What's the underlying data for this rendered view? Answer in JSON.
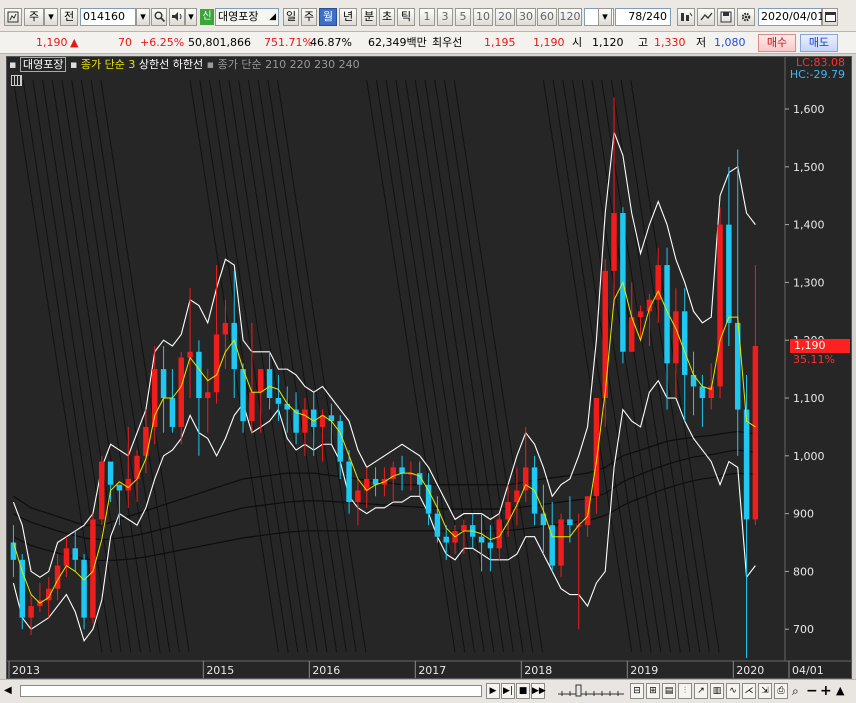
{
  "toolbar": {
    "period_select": "주",
    "prev_label": "전",
    "stock_code": "014160",
    "new_badge": "신",
    "stock_name": "대영포장",
    "period_tabs": [
      "일",
      "주",
      "월",
      "년",
      "분",
      "초",
      "틱"
    ],
    "active_tab": "월",
    "number_tabs": [
      "1",
      "3",
      "5",
      "10",
      "20",
      "30",
      "60",
      "120"
    ],
    "count": "78",
    "total": "/240",
    "date": "2020/04/01"
  },
  "quote": {
    "price": "1,190",
    "change": "70",
    "change_pct": "+6.25%",
    "volume": "50,801,866",
    "vol_ratio": "751.71%",
    "turnover": "46.87%",
    "amount": "62,349백만",
    "best_ask_label": "최우선",
    "best_ask": "1,195",
    "best_bid": "1,190",
    "open_label": "시",
    "open": "1,120",
    "high_label": "고",
    "high": "1,330",
    "low_label": "저",
    "low": "1,080",
    "buy_label": "매수",
    "sell_label": "매도"
  },
  "legend": {
    "name": "대영포장",
    "ma": "종가 단순 3",
    "upper": "상한선",
    "lower": "하한선",
    "ma2": "종가 단순",
    "periods": "210  220  230  240"
  },
  "indicators": {
    "lc": "LC:83.08",
    "hc": "HC:-29.79"
  },
  "price_tag": {
    "value": "1,190",
    "pct": "35.11%"
  },
  "colors": {
    "up": "#f01d1d",
    "down": "#1ec8f0",
    "ma": "#e6e600",
    "band": "#ffffff",
    "bg": "#262626"
  },
  "chart_data": {
    "type": "candlestick",
    "yticks": [
      700,
      800,
      900,
      1000,
      1100,
      1200,
      1300,
      1400,
      1500,
      1600
    ],
    "ytick_labels": [
      "700",
      "800",
      "900",
      "1,000",
      "1,100",
      "1,200",
      "1,300",
      "1,400",
      "1,500",
      "1,600"
    ],
    "ylim": [
      645,
      1690
    ],
    "xtick_labels": [
      "2013",
      "2015",
      "2016",
      "2017",
      "2018",
      "2019",
      "2020",
      "04/01"
    ],
    "xtick_index": [
      0,
      22,
      34,
      46,
      58,
      70,
      82,
      88
    ],
    "candles": [
      [
        850,
        880,
        790,
        820
      ],
      [
        820,
        830,
        700,
        720
      ],
      [
        720,
        760,
        690,
        740
      ],
      [
        740,
        780,
        730,
        750
      ],
      [
        750,
        790,
        720,
        770
      ],
      [
        770,
        830,
        750,
        810
      ],
      [
        810,
        860,
        790,
        840
      ],
      [
        840,
        870,
        800,
        820
      ],
      [
        820,
        830,
        700,
        720
      ],
      [
        720,
        900,
        710,
        890
      ],
      [
        890,
        1000,
        880,
        990
      ],
      [
        990,
        980,
        920,
        950
      ],
      [
        950,
        950,
        880,
        940
      ],
      [
        940,
        1050,
        910,
        960
      ],
      [
        960,
        1010,
        920,
        1000
      ],
      [
        1000,
        1080,
        970,
        1050
      ],
      [
        1050,
        1190,
        1020,
        1150
      ],
      [
        1150,
        1190,
        1040,
        1100
      ],
      [
        1100,
        1150,
        1040,
        1050
      ],
      [
        1050,
        1180,
        1020,
        1170
      ],
      [
        1170,
        1290,
        1100,
        1180
      ],
      [
        1180,
        1200,
        1000,
        1100
      ],
      [
        1100,
        1150,
        1040,
        1110
      ],
      [
        1110,
        1330,
        1090,
        1210
      ],
      [
        1210,
        1270,
        1150,
        1230
      ],
      [
        1230,
        1320,
        1100,
        1150
      ],
      [
        1150,
        1160,
        1040,
        1060
      ],
      [
        1060,
        1230,
        1040,
        1110
      ],
      [
        1110,
        1150,
        1040,
        1150
      ],
      [
        1150,
        1180,
        1080,
        1100
      ],
      [
        1100,
        1140,
        1060,
        1090
      ],
      [
        1090,
        1120,
        1040,
        1080
      ],
      [
        1080,
        1110,
        1020,
        1040
      ],
      [
        1040,
        1100,
        1000,
        1080
      ],
      [
        1080,
        1110,
        1000,
        1050
      ],
      [
        1050,
        1080,
        990,
        1070
      ],
      [
        1070,
        1090,
        1020,
        1060
      ],
      [
        1060,
        1070,
        960,
        990
      ],
      [
        990,
        1010,
        900,
        920
      ],
      [
        920,
        960,
        880,
        940
      ],
      [
        940,
        980,
        910,
        960
      ],
      [
        960,
        980,
        930,
        950
      ],
      [
        950,
        980,
        930,
        960
      ],
      [
        960,
        990,
        920,
        980
      ],
      [
        980,
        1000,
        940,
        970
      ],
      [
        970,
        990,
        940,
        970
      ],
      [
        970,
        990,
        930,
        950
      ],
      [
        950,
        970,
        880,
        900
      ],
      [
        900,
        930,
        850,
        860
      ],
      [
        860,
        880,
        820,
        850
      ],
      [
        850,
        880,
        830,
        870
      ],
      [
        870,
        890,
        830,
        880
      ],
      [
        880,
        900,
        840,
        860
      ],
      [
        860,
        900,
        800,
        850
      ],
      [
        850,
        880,
        800,
        840
      ],
      [
        840,
        900,
        820,
        890
      ],
      [
        890,
        950,
        860,
        920
      ],
      [
        920,
        980,
        880,
        940
      ],
      [
        940,
        1050,
        920,
        980
      ],
      [
        980,
        1000,
        880,
        900
      ],
      [
        900,
        950,
        830,
        880
      ],
      [
        880,
        920,
        800,
        810
      ],
      [
        810,
        900,
        790,
        890
      ],
      [
        890,
        930,
        850,
        880
      ],
      [
        880,
        900,
        700,
        880
      ],
      [
        880,
        930,
        860,
        930
      ],
      [
        930,
        1010,
        900,
        1100
      ],
      [
        1100,
        1340,
        1050,
        1320
      ],
      [
        1320,
        1620,
        1260,
        1420
      ],
      [
        1420,
        1430,
        1160,
        1180
      ],
      [
        1180,
        1300,
        1180,
        1240
      ],
      [
        1240,
        1260,
        1200,
        1250
      ],
      [
        1250,
        1280,
        1190,
        1270
      ],
      [
        1270,
        1360,
        1230,
        1330
      ],
      [
        1330,
        1360,
        1080,
        1160
      ],
      [
        1160,
        1290,
        1100,
        1250
      ],
      [
        1250,
        1290,
        1060,
        1140
      ],
      [
        1140,
        1180,
        1070,
        1120
      ],
      [
        1120,
        1140,
        1050,
        1100
      ],
      [
        1100,
        1160,
        1080,
        1120
      ],
      [
        1120,
        1430,
        1100,
        1400
      ],
      [
        1400,
        1500,
        1190,
        1230
      ],
      [
        1230,
        1530,
        1000,
        1080
      ],
      [
        1080,
        1140,
        650,
        890
      ],
      [
        890,
        1330,
        880,
        1190
      ]
    ],
    "ma3": [
      850,
      800,
      760,
      745,
      755,
      785,
      810,
      800,
      785,
      800,
      855,
      940,
      955,
      945,
      960,
      995,
      1070,
      1100,
      1100,
      1120,
      1170,
      1150,
      1130,
      1140,
      1180,
      1200,
      1150,
      1110,
      1110,
      1120,
      1115,
      1090,
      1075,
      1070,
      1060,
      1070,
      1060,
      1040,
      1000,
      960,
      940,
      950,
      955,
      965,
      970,
      970,
      965,
      940,
      910,
      875,
      860,
      870,
      870,
      865,
      855,
      860,
      885,
      915,
      950,
      940,
      905,
      860,
      860,
      860,
      880,
      895,
      990,
      1110,
      1270,
      1300,
      1240,
      1200,
      1255,
      1285,
      1250,
      1220,
      1180,
      1140,
      1120,
      1115,
      1200,
      1240,
      1240,
      1060,
      1050
    ],
    "upper": [
      920,
      880,
      800,
      790,
      800,
      850,
      860,
      870,
      880,
      900,
      980,
      1020,
      1010,
      1000,
      1040,
      1080,
      1180,
      1200,
      1190,
      1210,
      1270,
      1260,
      1230,
      1290,
      1340,
      1330,
      1200,
      1180,
      1180,
      1180,
      1150,
      1150,
      1140,
      1120,
      1110,
      1120,
      1100,
      1080,
      1060,
      1010,
      980,
      990,
      1000,
      1010,
      1020,
      1010,
      1000,
      980,
      950,
      920,
      890,
      900,
      900,
      900,
      890,
      900,
      950,
      1000,
      1040,
      1020,
      980,
      930,
      950,
      960,
      1000,
      1050,
      1200,
      1420,
      1560,
      1520,
      1420,
      1350,
      1400,
      1440,
      1400,
      1340,
      1300,
      1250,
      1230,
      1240,
      1450,
      1490,
      1500,
      1420,
      1400
    ],
    "lower": [
      780,
      720,
      700,
      710,
      720,
      740,
      760,
      730,
      680,
      700,
      750,
      860,
      900,
      890,
      880,
      910,
      960,
      1000,
      1010,
      1030,
      1070,
      1040,
      1030,
      1000,
      1030,
      1070,
      1090,
      1040,
      1050,
      1060,
      1080,
      1030,
      1010,
      1020,
      1010,
      1020,
      1020,
      990,
      930,
      910,
      900,
      910,
      910,
      920,
      920,
      930,
      930,
      900,
      860,
      830,
      820,
      840,
      840,
      830,
      820,
      820,
      820,
      830,
      860,
      860,
      830,
      800,
      770,
      760,
      760,
      740,
      780,
      800,
      980,
      1080,
      1060,
      1050,
      1110,
      1130,
      1100,
      1100,
      1060,
      1030,
      1010,
      990,
      950,
      990,
      980,
      790,
      810
    ],
    "long_mas": [
      [
        930,
        920,
        910,
        905,
        900,
        895,
        890,
        885,
        880,
        880,
        880,
        885,
        890,
        895,
        900,
        905,
        910,
        915,
        920,
        925,
        930,
        935,
        940,
        945,
        950,
        955,
        960,
        962,
        964,
        966,
        968,
        970,
        970,
        970,
        970,
        968,
        966,
        964,
        962,
        960,
        958,
        956,
        954,
        952,
        950,
        950,
        950,
        950,
        950,
        950,
        950,
        950,
        950,
        950,
        950,
        950,
        950,
        952,
        955,
        958,
        960,
        962,
        964,
        966,
        968,
        970,
        975,
        980,
        990,
        1000,
        1005,
        1010,
        1015,
        1020,
        1025,
        1028,
        1030,
        1032,
        1034,
        1035,
        1038,
        1040,
        1042,
        1040,
        1038
      ],
      [
        900,
        892,
        885,
        880,
        875,
        870,
        866,
        862,
        858,
        856,
        855,
        856,
        858,
        860,
        863,
        866,
        870,
        874,
        878,
        882,
        886,
        890,
        894,
        898,
        902,
        906,
        910,
        912,
        914,
        916,
        918,
        920,
        921,
        922,
        922,
        922,
        921,
        920,
        919,
        918,
        917,
        916,
        915,
        914,
        913,
        912,
        911,
        910,
        909,
        908,
        908,
        908,
        908,
        908,
        908,
        908,
        909,
        910,
        912,
        914,
        916,
        918,
        920,
        922,
        924,
        926,
        930,
        935,
        945,
        955,
        962,
        968,
        974,
        980,
        985,
        990,
        994,
        998,
        1000,
        1002,
        1005,
        1008,
        1010,
        1008,
        1006
      ],
      [
        860,
        852,
        845,
        840,
        836,
        832,
        828,
        825,
        822,
        820,
        819,
        819,
        820,
        821,
        823,
        825,
        828,
        831,
        834,
        837,
        840,
        843,
        846,
        849,
        852,
        855,
        858,
        860,
        862,
        864,
        866,
        868,
        869,
        870,
        870,
        870,
        870,
        870,
        870,
        870,
        870,
        870,
        870,
        870,
        870,
        870,
        870,
        870,
        870,
        870,
        870,
        870,
        870,
        870,
        870,
        870,
        871,
        872,
        874,
        876,
        878,
        880,
        882,
        884,
        886,
        888,
        892,
        897,
        905,
        914,
        921,
        927,
        933,
        939,
        944,
        949,
        953,
        957,
        960,
        962,
        965,
        968,
        970,
        969,
        968
      ]
    ],
    "fan_sets": [
      {
        "start": 0,
        "len": 10,
        "top": 1650,
        "bottom": 660,
        "lines": 10
      },
      {
        "start": 20,
        "len": 10,
        "top": 1650,
        "bottom": 660,
        "lines": 10
      },
      {
        "start": 40,
        "len": 10,
        "top": 1650,
        "bottom": 660,
        "lines": 10
      },
      {
        "start": 60,
        "len": 10,
        "top": 1650,
        "bottom": 660,
        "lines": 10
      }
    ]
  }
}
